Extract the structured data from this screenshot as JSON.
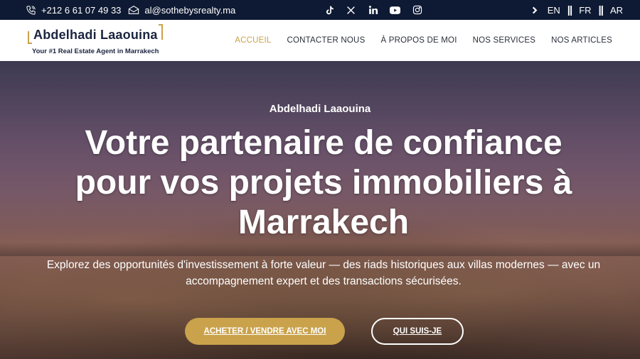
{
  "topbar": {
    "phone": "+212 6 61 07 49 33",
    "email": "al@sothebysrealty.ma",
    "social": [
      "tiktok-icon",
      "x-icon",
      "linkedin-icon",
      "youtube-icon",
      "instagram-icon"
    ],
    "languages": [
      "EN",
      "FR",
      "AR"
    ],
    "separator": "||"
  },
  "brand": {
    "name": "Abdelhadi Laaouina",
    "tagline": "Your #1 Real Estate Agent in Marrakech",
    "accent": "#c9a24b",
    "navy": "#0e1a33"
  },
  "nav": {
    "items": [
      "ACCUEIL",
      "CONTACTER NOUS",
      "À PROPOS DE MOI",
      "NOS SERVICES",
      "NOS ARTICLES"
    ],
    "active": "ACCUEIL"
  },
  "hero": {
    "subtitle": "Abdelhadi Laaouina",
    "title_lines": [
      "Votre partenaire de confiance",
      "pour vos projets immobiliers à",
      "Marrakech"
    ],
    "text_lines": [
      "Explorez des opportunités d'investissement à forte valeur — des riads historiques aux villas modernes — avec un",
      "accompagnement expert et des transactions sécurisées."
    ],
    "primary_button": "ACHETER / VENDRE AVEC MOI",
    "secondary_button": "QUI SUIS-JE"
  }
}
